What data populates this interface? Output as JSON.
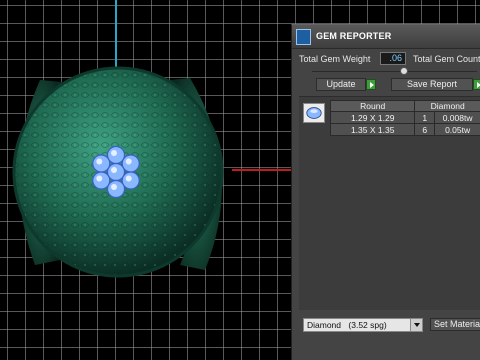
{
  "panel": {
    "title": "GEM REPORTER",
    "total_weight_label": "Total Gem Weight",
    "total_weight_value": ".06",
    "total_count_label": "Total Gem Count",
    "update_label": "Update",
    "save_report_label": "Save Report",
    "table": {
      "headers": [
        "Round",
        "Diamond"
      ],
      "rows": [
        {
          "size": "1.29 X 1.29",
          "qty": "1",
          "weight": "0.008tw"
        },
        {
          "size": "1.35 X 1.35",
          "qty": "6",
          "weight": "0.05tw"
        }
      ]
    },
    "material": {
      "selected": "Diamond",
      "sg": "(3.52 spg)"
    },
    "set_material_label": "Set Material"
  },
  "colors": {
    "gem_body": "#1f6b52",
    "stones": "#8ab8ff",
    "axis_y": "#2aa7c4",
    "axis_x": "#c41a1a",
    "go_button": "#3f9c3b"
  }
}
